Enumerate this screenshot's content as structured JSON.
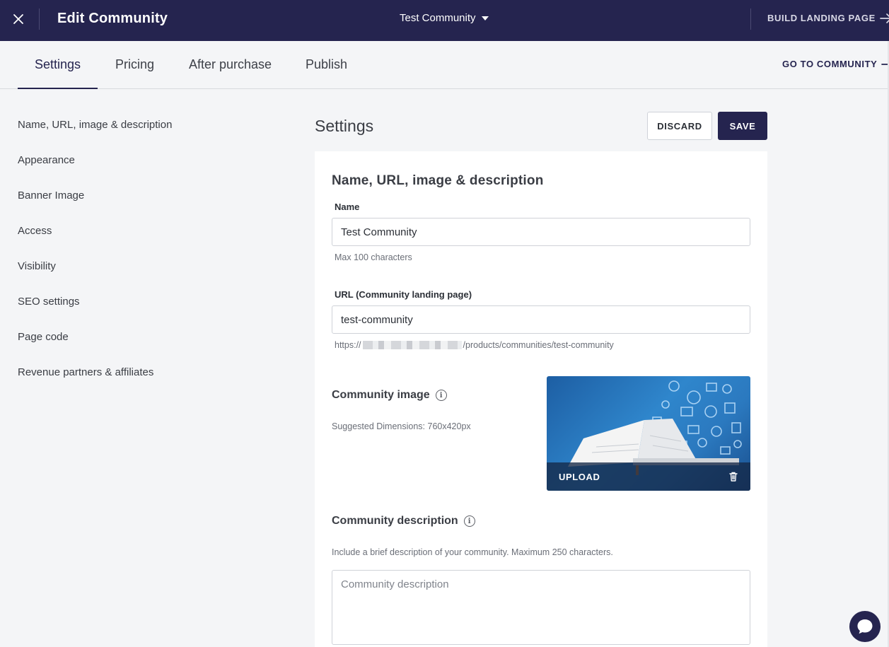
{
  "header": {
    "title": "Edit Community",
    "community_switcher": "Test Community",
    "build_landing_page": "BUILD LANDING PAGE"
  },
  "tabs": [
    {
      "label": "Settings",
      "active": true
    },
    {
      "label": "Pricing",
      "active": false
    },
    {
      "label": "After purchase",
      "active": false
    },
    {
      "label": "Publish",
      "active": false
    }
  ],
  "go_to_community": "GO TO COMMUNITY",
  "sidebar": {
    "items": [
      {
        "label": "Name, URL, image & description"
      },
      {
        "label": "Appearance"
      },
      {
        "label": "Banner Image"
      },
      {
        "label": "Access"
      },
      {
        "label": "Visibility"
      },
      {
        "label": "SEO settings"
      },
      {
        "label": "Page code"
      },
      {
        "label": "Revenue partners & affiliates"
      }
    ]
  },
  "main": {
    "title": "Settings",
    "discard_label": "DISCARD",
    "save_label": "SAVE"
  },
  "form": {
    "section_title": "Name, URL, image & description",
    "name_label": "Name",
    "name_value": "Test Community",
    "name_hint": "Max 100 characters",
    "url_label": "URL (Community landing page)",
    "url_value": "test-community",
    "url_prefix": "https://",
    "url_suffix": "/products/communities/test-community",
    "image_label": "Community image",
    "image_hint": "Suggested Dimensions: 760x420px",
    "upload_label": "UPLOAD",
    "description_label": "Community description",
    "description_hint": "Include a brief description of your community. Maximum 250 characters.",
    "description_placeholder": "Community description"
  },
  "colors": {
    "navy": "#25244f",
    "page_bg": "#f4f5f7",
    "border": "#cfd2d8"
  }
}
